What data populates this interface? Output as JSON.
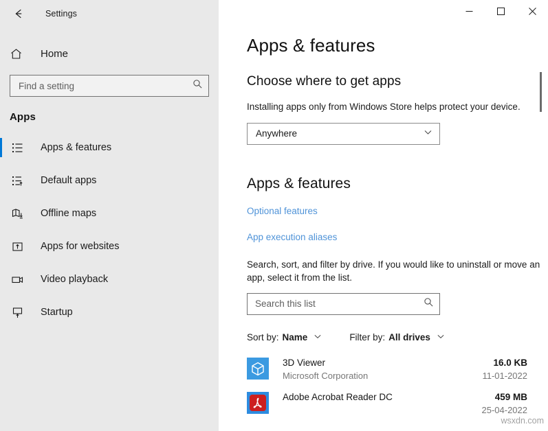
{
  "window": {
    "title": "Settings",
    "back_icon": "back-arrow-icon",
    "controls": {
      "minimize": "minimize-icon",
      "maximize": "maximize-icon",
      "close": "close-icon"
    }
  },
  "sidebar": {
    "home_label": "Home",
    "home_icon": "home-icon",
    "search": {
      "placeholder": "Find a setting",
      "value": "",
      "icon": "search-icon"
    },
    "category_label": "Apps",
    "items": [
      {
        "label": "Apps & features",
        "icon": "list-bullets-icon",
        "selected": true
      },
      {
        "label": "Default apps",
        "icon": "list-arrow-icon",
        "selected": false
      },
      {
        "label": "Offline maps",
        "icon": "map-download-icon",
        "selected": false
      },
      {
        "label": "Apps for websites",
        "icon": "box-arrow-up-icon",
        "selected": false
      },
      {
        "label": "Video playback",
        "icon": "video-camera-icon",
        "selected": false
      },
      {
        "label": "Startup",
        "icon": "monitor-arrow-up-icon",
        "selected": false
      }
    ]
  },
  "main": {
    "page_title": "Apps & features",
    "choose_source": {
      "heading": "Choose where to get apps",
      "description": "Installing apps only from Windows Store helps protect your device.",
      "dropdown_value": "Anywhere",
      "dropdown_icon": "chevron-down-icon"
    },
    "apps_features": {
      "heading": "Apps & features",
      "links": [
        {
          "label": "Optional features"
        },
        {
          "label": "App execution aliases"
        }
      ],
      "description": "Search, sort, and filter by drive. If you would like to uninstall or move an app, select it from the list.",
      "search": {
        "placeholder": "Search this list",
        "value": "",
        "icon": "search-icon"
      },
      "sort_by": {
        "label": "Sort by:",
        "value": "Name",
        "icon": "chevron-down-icon"
      },
      "filter_by": {
        "label": "Filter by:",
        "value": "All drives",
        "icon": "chevron-down-icon"
      }
    },
    "app_list": [
      {
        "name": "3D Viewer",
        "publisher": "Microsoft Corporation",
        "size": "16.0 KB",
        "date": "11-01-2022",
        "icon": "cube-3d-icon",
        "icon_bg": "#3b9ae1",
        "icon_fg": "#ffffff"
      },
      {
        "name": "Adobe Acrobat Reader DC",
        "publisher": "",
        "size": "459 MB",
        "date": "25-04-2022",
        "icon": "adobe-acrobat-icon",
        "icon_bg": "#2d8ce0",
        "icon_fg": "#cc1f1f"
      }
    ]
  },
  "watermark": {
    "text": "wsxdn.com"
  },
  "colors": {
    "accent": "#0078d7",
    "link": "#4f93d8",
    "sidebar_bg": "#e9e9e9",
    "main_bg": "#ffffff",
    "scrollbar": "#6b6b6b"
  }
}
